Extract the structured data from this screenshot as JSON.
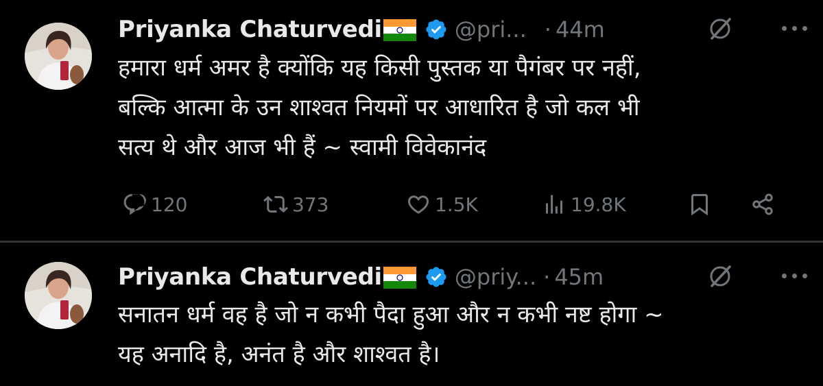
{
  "tweets": [
    {
      "author_name": "Priyanka Chaturvedi",
      "handle": "@pri...",
      "separator": "·",
      "time": "44m",
      "lines": [
        "हमारा धर्म अमर है क्योंकि यह किसी पुस्तक या पैगंबर पर नहीं,",
        "बल्कि आत्मा के उन शाश्वत नियमों पर आधारित है जो कल भी",
        "सत्य थे और आज भी हैं ~ स्वामी विवेकानंद"
      ],
      "replies": "120",
      "reposts": "373",
      "likes": "1.5K",
      "views": "19.8K"
    },
    {
      "author_name": "Priyanka Chaturvedi",
      "handle": "@priy...",
      "separator": "·",
      "time": "45m",
      "lines": [
        "सनातन धर्म वह है जो न कभी पैदा हुआ और न कभी नष्ट होगा ~",
        "यह अनादि है, अनंत है और शाश्वत है।"
      ]
    }
  ],
  "icons": {
    "flag": "india-flag-icon",
    "verified": "verified-badge-icon",
    "grok": "grok-icon",
    "more": "more-options-icon",
    "reply": "reply-icon",
    "repost": "repost-icon",
    "like": "like-icon",
    "views": "views-icon",
    "bookmark": "bookmark-icon",
    "share": "share-icon"
  },
  "colors": {
    "background": "#000000",
    "text": "#e7e9ea",
    "muted": "#71767b",
    "verified": "#1d9bf0",
    "divider": "#2f3336"
  }
}
